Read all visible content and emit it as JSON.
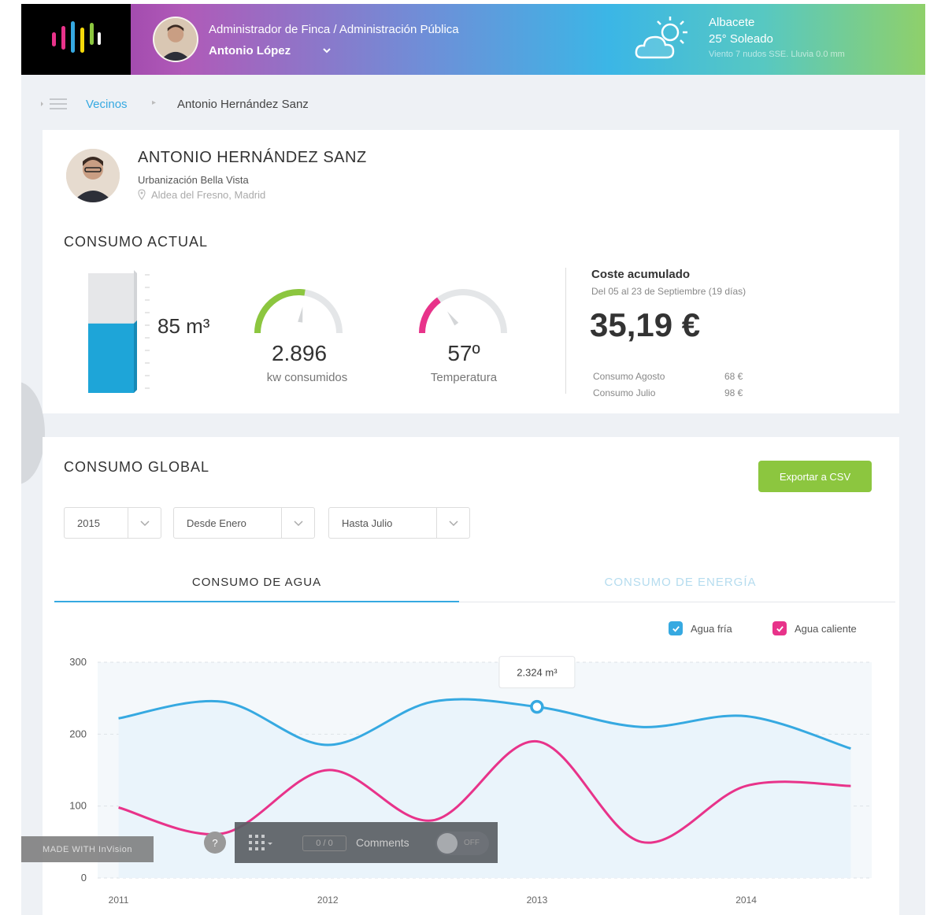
{
  "header": {
    "role": "Administrador de Finca / Administración Pública",
    "user_name": "Antonio López",
    "weather": {
      "city": "Albacete",
      "temp": "25° Soleado",
      "details": "Viento 7 nudos SSE. Lluvia 0.0 mm"
    }
  },
  "breadcrumb": {
    "link": "Vecinos",
    "current": "Antonio Hernández Sanz"
  },
  "profile": {
    "name": "ANTONIO HERNÁNDEZ SANZ",
    "organization": "Urbanización Bella Vista",
    "location": "Aldea del Fresno, Madrid"
  },
  "consumo_actual": {
    "title": "CONSUMO ACTUAL",
    "water_value": "85 m³",
    "water_fill": 0.58,
    "energy_value": "2.896",
    "energy_label": "kw consumidos",
    "energy_fraction": 0.55,
    "temp_value": "57º",
    "temp_label": "Temperatura",
    "temp_fraction": 0.3
  },
  "coste": {
    "title": "Coste acumulado",
    "subtitle": "Del 05 al 23 de Septiembre (19 días)",
    "value": "35,19 €",
    "rows": [
      {
        "label": "Consumo Agosto",
        "value": "68 €"
      },
      {
        "label": "Consumo Julio",
        "value": "98 €"
      }
    ]
  },
  "consumo_global": {
    "title": "CONSUMO GLOBAL",
    "export_label": "Exportar a CSV",
    "filters": {
      "year": "2015",
      "from": "Desde Enero",
      "to": "Hasta Julio"
    },
    "tabs": [
      {
        "label": "CONSUMO DE AGUA",
        "active": true
      },
      {
        "label": "CONSUMO DE ENERGÍA",
        "active": false
      }
    ],
    "legend": [
      {
        "label": "Agua fría",
        "color": "#36a9e1"
      },
      {
        "label": "Agua caliente",
        "color": "#e8338a"
      }
    ],
    "tooltip": "2.324 m³"
  },
  "chart_data": {
    "type": "line",
    "x": [
      2011,
      2011.5,
      2012,
      2012.5,
      2013,
      2013.5,
      2014,
      2014.5
    ],
    "x_tick_labels": [
      "2011",
      "2012",
      "2013",
      "2014"
    ],
    "y_ticks": [
      0,
      100,
      200,
      300
    ],
    "ylim": [
      0,
      300
    ],
    "grid": true,
    "legend_position": "top-right",
    "series": [
      {
        "name": "Agua fría",
        "color": "#36a9e1",
        "values": [
          222,
          245,
          185,
          245,
          238,
          210,
          225,
          180
        ]
      },
      {
        "name": "Agua caliente",
        "color": "#e8338a",
        "values": [
          98,
          62,
          150,
          80,
          190,
          50,
          128,
          128
        ]
      }
    ],
    "highlight": {
      "x": 2013,
      "y": 238,
      "label": "2.324 m³"
    }
  },
  "invision": {
    "badge": "MADE WITH InVision",
    "help": "?",
    "counter": "0 / 0",
    "comments": "Comments",
    "toggle": "OFF"
  }
}
